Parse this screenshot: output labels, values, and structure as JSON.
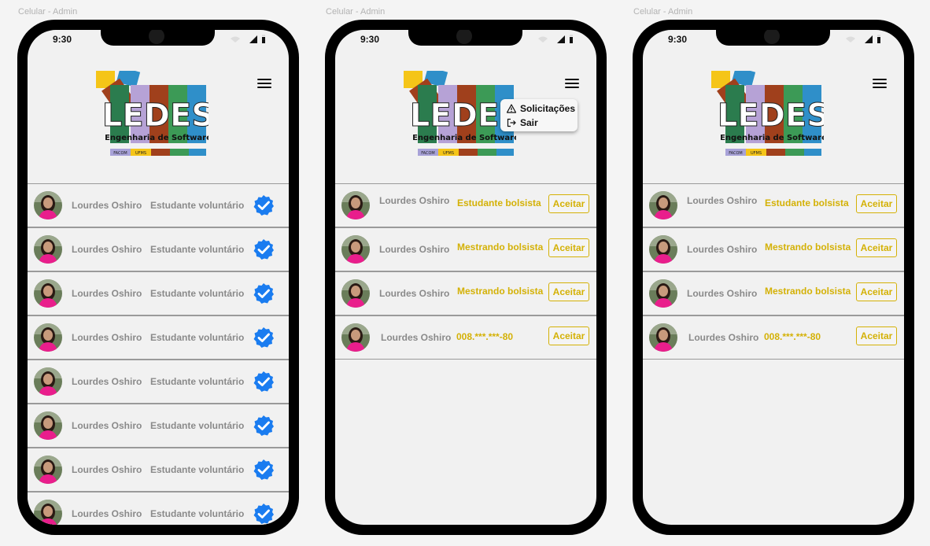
{
  "frame_label": "Celular - Admin",
  "status_time": "9:30",
  "colors": {
    "gold": "#d4b106",
    "verified_blue": "#1a7cf0",
    "text_gray": "#8a8a8a"
  },
  "logo": {
    "letters": "LEDES",
    "subtitle": "Engenharia de Software",
    "tag_left": "FACOM",
    "tag_right": "UFMS"
  },
  "menu": {
    "solicitacoes": "Solicitações",
    "sair": "Sair"
  },
  "screen1": {
    "rows": [
      {
        "name": "Lourdes Oshiro",
        "role": "Estudante voluntário"
      },
      {
        "name": "Lourdes Oshiro",
        "role": "Estudante voluntário"
      },
      {
        "name": "Lourdes Oshiro",
        "role": "Estudante voluntário"
      },
      {
        "name": "Lourdes Oshiro",
        "role": "Estudante voluntário"
      },
      {
        "name": "Lourdes Oshiro",
        "role": "Estudante voluntário"
      },
      {
        "name": "Lourdes Oshiro",
        "role": "Estudante voluntário"
      },
      {
        "name": "Lourdes Oshiro",
        "role": "Estudante voluntário"
      },
      {
        "name": "Lourdes Oshiro",
        "role": "Estudante voluntário"
      }
    ]
  },
  "screen2": {
    "rows": [
      {
        "name": "Lourdes Oshiro",
        "role": "Estudante bolsista",
        "action": "Aceitar"
      },
      {
        "name": "Lourdes Oshiro",
        "role": "Mestrando bolsista",
        "action": "Aceitar"
      },
      {
        "name": "Lourdes Oshiro",
        "role": "Mestrando bolsista",
        "action": "Aceitar"
      },
      {
        "name": "Lourdes Oshiro",
        "role": "008.***.***-80",
        "action": "Aceitar"
      }
    ]
  },
  "screen3": {
    "rows": [
      {
        "name": "Lourdes Oshiro",
        "role": "Estudante bolsista",
        "action": "Aceitar"
      },
      {
        "name": "Lourdes Oshiro",
        "role": "Mestrando bolsista",
        "action": "Aceitar"
      },
      {
        "name": "Lourdes Oshiro",
        "role": "Mestrando bolsista",
        "action": "Aceitar"
      },
      {
        "name": "Lourdes Oshiro",
        "role": "008.***.***-80",
        "action": "Aceitar"
      }
    ]
  }
}
